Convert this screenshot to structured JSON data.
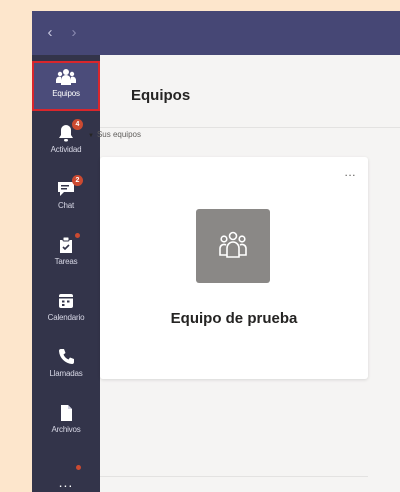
{
  "titlebar": {
    "back_icon": "chevron-left-icon",
    "forward_icon": "chevron-right-icon"
  },
  "rail": {
    "items": [
      {
        "label": "Equipos",
        "icon": "teams-icon",
        "active": true
      },
      {
        "label": "Actividad",
        "icon": "bell-icon",
        "badge": "4"
      },
      {
        "label": "Chat",
        "icon": "chat-icon",
        "badge": "2"
      },
      {
        "label": "Tareas",
        "icon": "tasks-icon",
        "dot": true
      },
      {
        "label": "Calendario",
        "icon": "calendar-icon"
      },
      {
        "label": "Llamadas",
        "icon": "phone-icon"
      },
      {
        "label": "Archivos",
        "icon": "files-icon"
      }
    ],
    "more_label": "...",
    "more_dot": true
  },
  "header": {
    "title": "Equipos"
  },
  "section": {
    "label": "Sus equipos"
  },
  "team_card": {
    "name": "Equipo de prueba",
    "more_label": "...",
    "avatar_icon": "team-avatar-icon"
  },
  "colors": {
    "titlebar": "#464775",
    "rail": "#33344a",
    "active_item": "#4b4c7a",
    "active_outline": "#d9262c",
    "badge": "#cc4a31",
    "avatar": "#8a8886",
    "background": "#fde6cc"
  }
}
